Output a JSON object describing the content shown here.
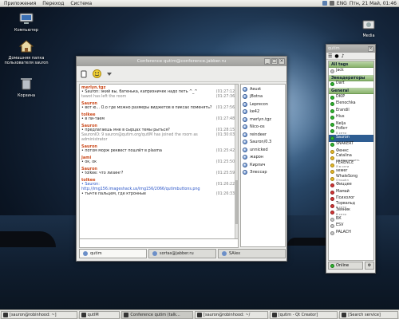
{
  "panel": {
    "menus": [
      "Приложения",
      "Переход",
      "Система"
    ],
    "clock": "Птн, 21 Май, 01:46",
    "tray_label": "ENG"
  },
  "desktop": {
    "icons": [
      {
        "label": "Компьютер",
        "icon": "computer-icon"
      },
      {
        "label": "Домашняя папка пользователя sauron",
        "icon": "home-folder-icon"
      },
      {
        "label": "Корзина",
        "icon": "trash-icon"
      },
      {
        "label": "Media",
        "icon": "media-drive-icon"
      }
    ]
  },
  "chat": {
    "title": "Conference qutim@conference.jabber.ru",
    "toolbar": [
      "send-icon",
      "emoticon-icon",
      "history-icon"
    ],
    "messages": [
      {
        "nick": "merlyn.tgz",
        "lines": [
          {
            "text": "• Sauron: экий вы, батенька, капризничек надо петь ^_^",
            "time": "(01:27:12)"
          },
          {
            "text": "tawot has left the room",
            "time": "(01:27:36)",
            "system": true
          }
        ]
      },
      {
        "nick": "Sauron",
        "lines": [
          {
            "text": "• вот ю... О.о где можно размеры виджетов в пиксах поменять?",
            "time": "(01:27:56)"
          }
        ]
      },
      {
        "nick": "tolkee",
        "lines": [
          {
            "text": "• в пи-таем",
            "time": "(01:27:48)"
          }
        ]
      },
      {
        "nick": "Sauron",
        "lines": [
          {
            "text": "• предлагаешь мне в сырцах темы рыться?",
            "time": "(01:28:15)"
          },
          {
            "text": "SauronIO: 9 sauron@qutim.org/qutIM has joined the room as administrator",
            "time": "(01:30:03)",
            "system": true
          }
        ]
      },
      {
        "nick": "Sauron",
        "lines": [
          {
            "text": "• потом морж реквест пошлёт в plasma",
            "time": "(01:25:42)"
          }
        ]
      },
      {
        "nick": "Jami",
        "lines": [
          {
            "text": "• ок, ок",
            "time": "(01:25:50)"
          }
        ]
      },
      {
        "nick": "Sauron",
        "lines": [
          {
            "text": "• tolkee: что лизинг?",
            "time": "(01:25:59)"
          }
        ]
      },
      {
        "nick": "tolkee",
        "lines": [
          {
            "text": "• Sauron: http://img156.imageshack.us/img156/2066/qutimbuttons.png",
            "time": "(01:26:22)",
            "link": true
          },
          {
            "text": "• тычте пальцем, где ктронные",
            "time": "(01:26:33)"
          }
        ]
      }
    ],
    "users": [
      "Aeust",
      "jBotna",
      "Leprecon",
      "ke42",
      "merlyn.tgz",
      "Nico-os",
      "reindeer",
      "Sauron/0.3",
      "unnicked",
      "жарон",
      "Кирпич",
      "Элессар"
    ],
    "tabs": [
      "qutim",
      "sortas@jabber.ru",
      "SAlex"
    ]
  },
  "roster": {
    "title": "qutim",
    "groups": [
      {
        "name": "All tags",
        "contacts": [
          {
            "name": "jack",
            "status": "off"
          }
        ]
      },
      {
        "name": "Эвеадераторы",
        "contacts": [
          {
            "name": "Dart",
            "status": "on"
          }
        ]
      },
      {
        "name": "General",
        "contacts": [
          {
            "name": "DKIP",
            "status": "on"
          },
          {
            "name": "Elenochka",
            "status": "on"
          },
          {
            "name": "Erandil",
            "status": "on"
          },
          {
            "name": "Hius",
            "status": "on"
          },
          {
            "name": "Nelja",
            "status": "on"
          },
          {
            "name": "Робот",
            "status": "on",
            "sub": "В сети"
          },
          {
            "name": "Sauron",
            "status": "on",
            "selected": true
          },
          {
            "name": "SNAKERT",
            "status": "on"
          },
          {
            "name": "Фенкс",
            "status": "away"
          },
          {
            "name": "Catalina",
            "status": "away",
            "sub": "Не беспокоить"
          },
          {
            "name": "FERENCE",
            "status": "away",
            "sub": "Я в сети"
          },
          {
            "name": "sewer",
            "status": "away"
          },
          {
            "name": "WhaleSong",
            "status": "away",
            "sub": "Отошёл"
          },
          {
            "name": "Фиццее",
            "status": "dnd"
          },
          {
            "name": "Мамай",
            "status": "dnd"
          },
          {
            "name": "Психолог",
            "status": "dnd"
          },
          {
            "name": "Торвальд",
            "status": "dnd",
            "sub": "В сети"
          },
          {
            "name": "Звяник",
            "status": "dnd",
            "sub": "В сети"
          },
          {
            "name": "БК",
            "status": "off"
          },
          {
            "name": "ESV",
            "status": "off"
          },
          {
            "name": "PALACH",
            "status": "off"
          }
        ]
      }
    ],
    "footer_status": "Online"
  },
  "taskbar": {
    "tasks": [
      "[sauron@robinhood: ~]",
      "qutIM",
      "Conference qutim (talk...",
      "[sauron@robinhood: ~/",
      "[qutim - Qt Creator]",
      "[Search service]"
    ]
  }
}
